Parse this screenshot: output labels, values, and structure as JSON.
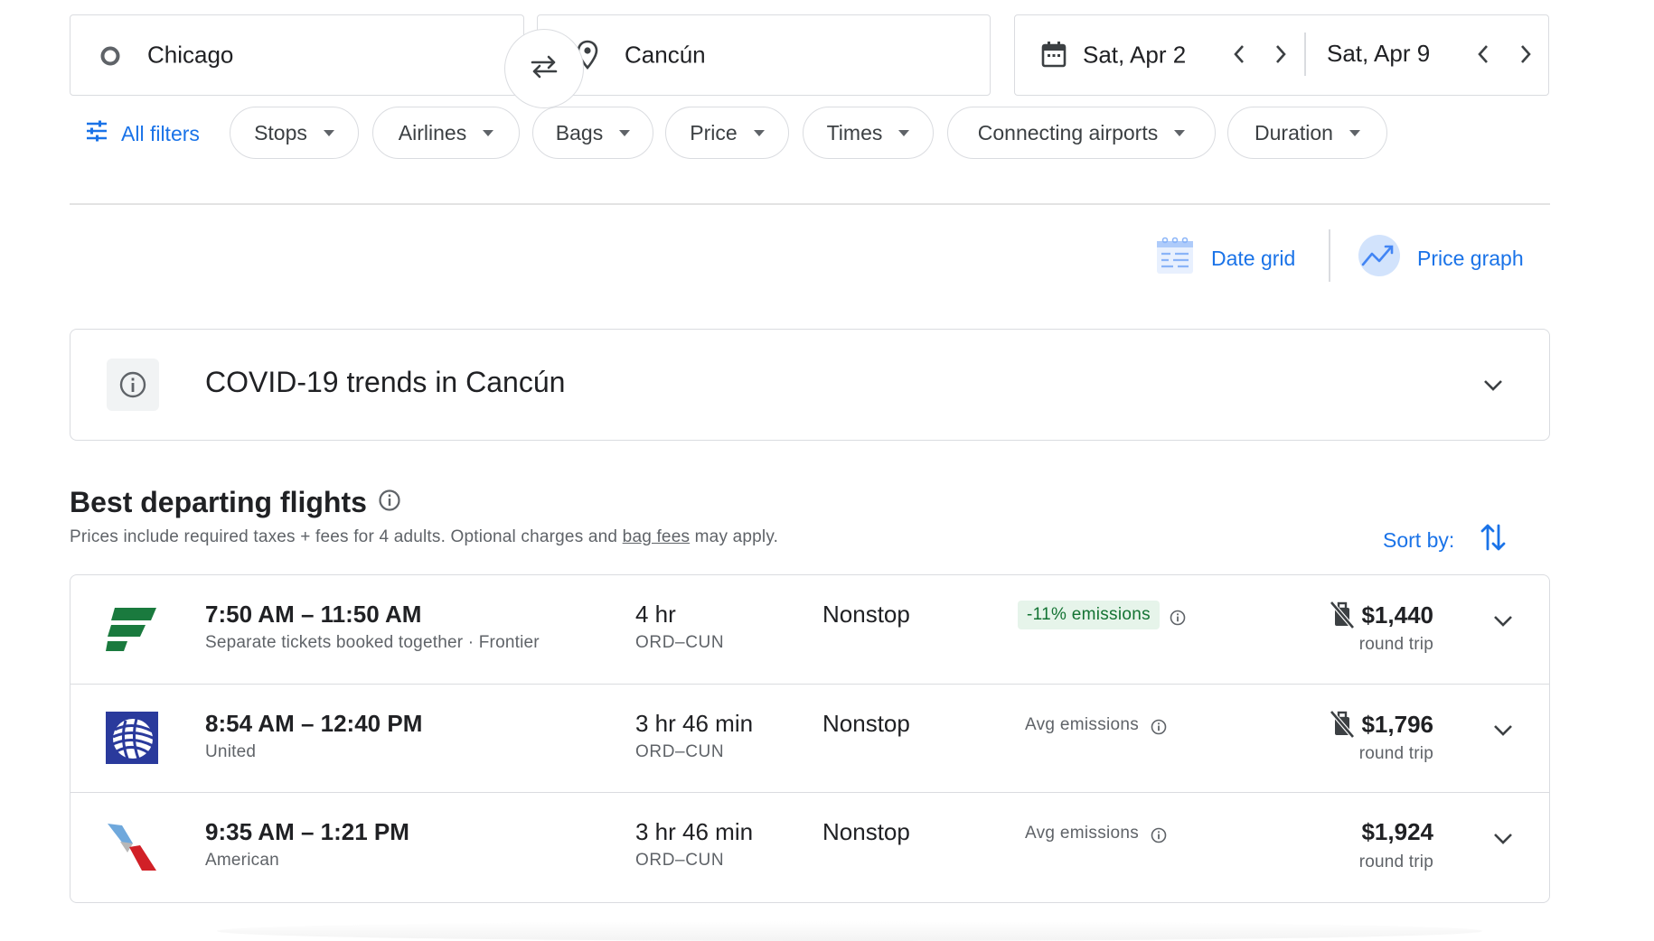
{
  "search": {
    "origin": "Chicago",
    "destination": "Cancún",
    "depart_date": "Sat, Apr 2",
    "return_date": "Sat, Apr 9"
  },
  "filters": {
    "all_filters": "All filters",
    "chips": [
      "Stops",
      "Airlines",
      "Bags",
      "Price",
      "Times",
      "Connecting airports",
      "Duration"
    ]
  },
  "views": {
    "date_grid": "Date grid",
    "price_graph": "Price graph"
  },
  "covid": {
    "title": "COVID-19 trends in Cancún"
  },
  "results": {
    "title": "Best departing flights",
    "subtitle_pre": "Prices include required taxes + fees for 4 adults. Optional charges and ",
    "subtitle_link": "bag fees",
    "subtitle_post": " may apply.",
    "sort_label": "Sort by:"
  },
  "flights": [
    {
      "airline_logo": "frontier-logo",
      "times": "7:50 AM – 11:50 AM",
      "carrier": "Separate tickets booked together · Frontier",
      "duration": "4 hr",
      "route": "ORD–CUN",
      "stops": "Nonstop",
      "emissions": "-11% emissions",
      "emissions_highlight": true,
      "price": "$1,440",
      "price_note": "round trip",
      "no_bag_icon": true
    },
    {
      "airline_logo": "united-logo",
      "times": "8:54 AM – 12:40 PM",
      "carrier": "United",
      "duration": "3 hr 46 min",
      "route": "ORD–CUN",
      "stops": "Nonstop",
      "emissions": "Avg emissions",
      "emissions_highlight": false,
      "price": "$1,796",
      "price_note": "round trip",
      "no_bag_icon": true
    },
    {
      "airline_logo": "american-logo",
      "times": "9:35 AM – 1:21 PM",
      "carrier": "American",
      "duration": "3 hr 46 min",
      "route": "ORD–CUN",
      "stops": "Nonstop",
      "emissions": "Avg emissions",
      "emissions_highlight": false,
      "price": "$1,924",
      "price_note": "round trip",
      "no_bag_icon": false
    }
  ],
  "colors": {
    "accent": "#1a73e8",
    "border": "#dadce0",
    "green_badge_bg": "#e6f4ea",
    "green_badge_text": "#137333",
    "frontier_green": "#1a7a3e",
    "united_blue": "#2a3a9c",
    "american_red": "#d12027"
  }
}
